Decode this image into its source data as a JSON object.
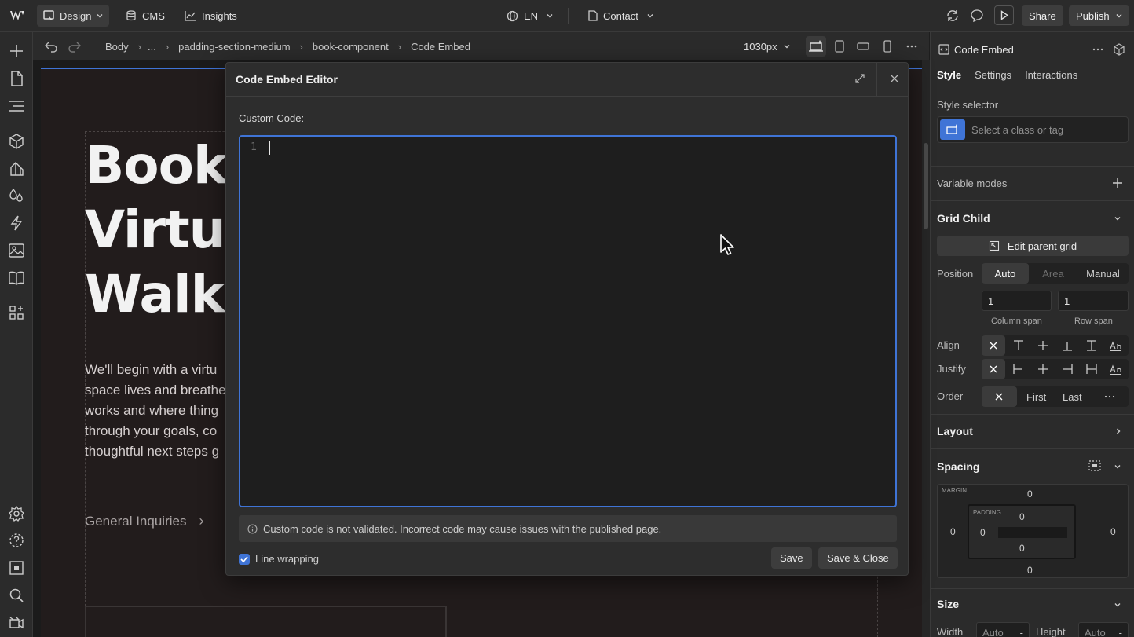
{
  "topbar": {
    "design_label": "Design",
    "cms_label": "CMS",
    "insights_label": "Insights",
    "locale_label": "EN",
    "page_label": "Contact",
    "share_label": "Share",
    "publish_label": "Publish"
  },
  "breadcrumb": {
    "items": [
      "Body",
      "...",
      "padding-section-medium",
      "book-component",
      "Code Embed"
    ],
    "width_label": "1030px"
  },
  "canvas": {
    "heading_lines": [
      "Book",
      "Virtua",
      "Walkt"
    ],
    "body_lines": [
      "We'll begin with a virtu",
      "space lives and breathe",
      "works and where thing",
      "through your goals, co",
      "thoughtful next steps g"
    ],
    "link_label": "General Inquiries"
  },
  "modal": {
    "title": "Code Embed Editor",
    "custom_code_label": "Custom Code:",
    "line_number": "1",
    "code_value": "",
    "warning_text": "Custom code is not validated. Incorrect code may cause issues with the published page.",
    "line_wrapping_label": "Line wrapping",
    "line_wrapping_checked": true,
    "save_label": "Save",
    "save_close_label": "Save & Close"
  },
  "panel": {
    "element_name": "Code Embed",
    "tabs": [
      "Style",
      "Settings",
      "Interactions"
    ],
    "style_selector_label": "Style selector",
    "style_selector_placeholder": "Select a class or tag",
    "variable_modes_label": "Variable modes",
    "grid_child_label": "Grid Child",
    "edit_parent_grid_label": "Edit parent grid",
    "position_label": "Position",
    "position_options": [
      "Auto",
      "Area",
      "Manual"
    ],
    "column_span_value": "1",
    "row_span_value": "1",
    "column_span_label": "Column span",
    "row_span_label": "Row span",
    "align_label": "Align",
    "justify_label": "Justify",
    "order_label": "Order",
    "order_options": [
      "First",
      "Last"
    ],
    "layout_label": "Layout",
    "spacing_label": "Spacing",
    "margin_label": "MARGIN",
    "padding_label": "PADDING",
    "margin_top": "0",
    "margin_left": "0",
    "margin_right": "0",
    "margin_bottom": "0",
    "padding_top": "0",
    "padding_left": "0",
    "padding_right": "0",
    "padding_bottom": "0",
    "size_label": "Size",
    "width_label": "Width",
    "height_label": "Height",
    "width_value": "Auto",
    "height_value": "Auto"
  },
  "colors": {
    "accent": "#3f74d6",
    "panel_bg": "#2b2b2b",
    "canvas_bg": "#221c1c"
  }
}
